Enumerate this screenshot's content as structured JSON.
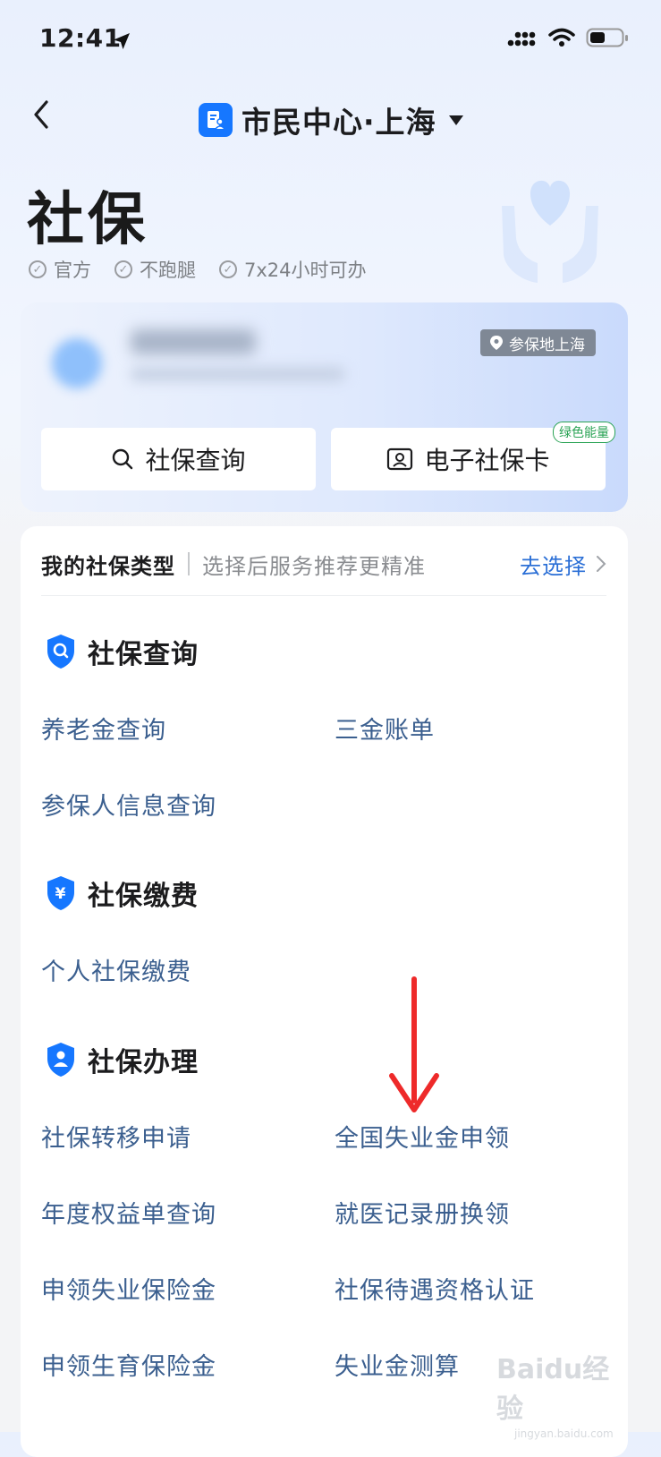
{
  "status_bar": {
    "time": "12:41"
  },
  "nav": {
    "title": "市民中心·上海"
  },
  "page": {
    "title": "社保",
    "tags": [
      "官方",
      "不跑腿",
      "7x24小时可办"
    ]
  },
  "account_card": {
    "insured_location": "参保地上海",
    "buttons": {
      "query": "社保查询",
      "ecard": "电子社保卡"
    },
    "green_badge": "绿色能量"
  },
  "type_selector": {
    "label": "我的社保类型",
    "hint": "选择后服务推荐更精准",
    "action": "去选择"
  },
  "groups": {
    "query": {
      "title": "社保查询",
      "items": [
        "养老金查询",
        "三金账单",
        "参保人信息查询"
      ]
    },
    "payment": {
      "title": "社保缴费",
      "items": [
        "个人社保缴费"
      ]
    },
    "handling": {
      "title": "社保办理",
      "items": [
        "社保转移申请",
        "全国失业金申领",
        "年度权益单查询",
        "就医记录册换领",
        "申领失业保险金",
        "社保待遇资格认证",
        "申领生育保险金",
        "失业金测算"
      ]
    }
  },
  "watermark": {
    "text": "Baidu经验",
    "sub": "jingyan.baidu.com"
  },
  "colors": {
    "brand_blue": "#1677ff",
    "link_blue": "#3b5f8f",
    "action_blue": "#2b6fd6",
    "annotation_red": "#ee2a2a",
    "green": "#2aa355"
  }
}
